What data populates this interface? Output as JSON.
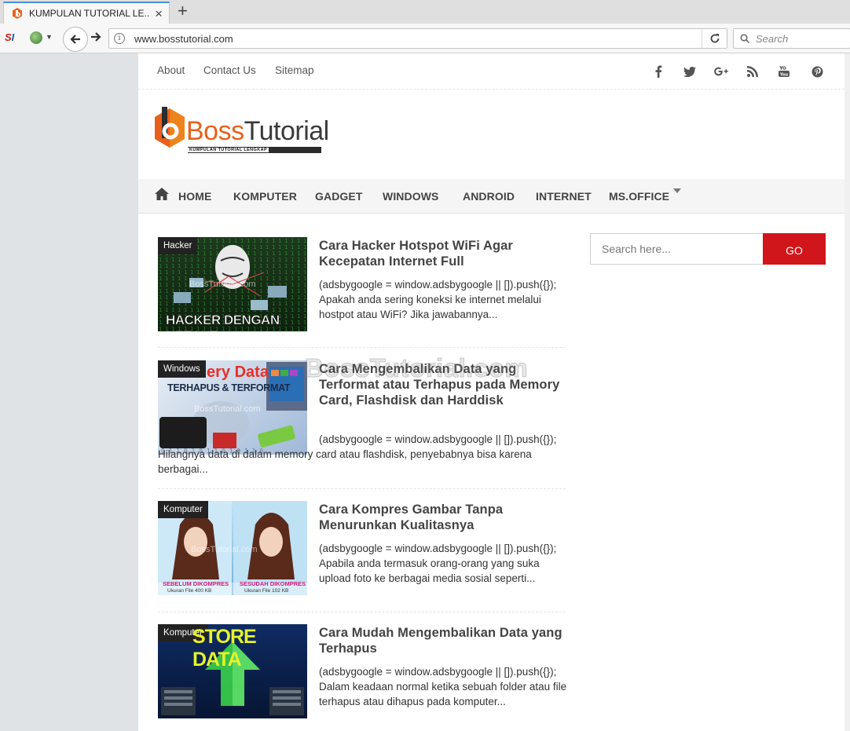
{
  "browser": {
    "tab_title": "KUMPULAN TUTORIAL LE...",
    "new_tab": "+",
    "close": "×",
    "url": "www.bosstutorial.com",
    "search_placeholder": "Search",
    "ext_si": "S",
    "ext_si_i": "I"
  },
  "topnav": {
    "links": [
      "About",
      "Contact Us",
      "Sitemap"
    ],
    "social_icons": [
      "facebook-icon",
      "twitter-icon",
      "google-plus-icon",
      "rss-icon",
      "youtube-icon",
      "pinterest-icon"
    ]
  },
  "logo": {
    "word_boss": "Boss",
    "word_tutorial": "Tutorial",
    "tagline": "KUMPULAN TUTORIAL LENGKAP"
  },
  "mainnav": {
    "items": [
      "HOME",
      "KOMPUTER",
      "GADGET",
      "WINDOWS",
      "ANDROID",
      "INTERNET",
      "MS.OFFICE"
    ]
  },
  "watermark": "BossTutorial.com",
  "posts": [
    {
      "category": "Hacker",
      "title": "Cara Hacker Hotspot WiFi Agar Kecepatan Internet Full",
      "excerpt": "(adsbygoogle = window.adsbygoogle || []).push({}); Apakah anda sering koneksi ke internet melalui hostpot atau WiFi? Jika jawabannya...",
      "thumb_caption": "HACKER DENGAN NETCUT",
      "thumb_watermark": "BossTutorial.com"
    },
    {
      "category": "Windows",
      "title": "Cara Mengembalikan Data yang Terformat atau Terhapus pada Memory Card, Flashdisk dan Harddisk",
      "excerpt": "(adsbygoogle = window.adsbygoogle || []).push({}); Hilangnya data di dalam memory card atau flashdisk, penyebabnya bisa karena berbagai...",
      "thumb_caption_1": "ery Data",
      "thumb_caption_2": "TERHAPUS & TERFORMAT",
      "thumb_watermark": "BossTutorial.com"
    },
    {
      "category": "Komputer",
      "title": "Cara Kompres Gambar Tanpa Menurunkan Kualitasnya",
      "excerpt": "(adsbygoogle = window.adsbygoogle || []).push({}); Apabila anda termasuk orang-orang yang suka upload foto ke berbagai media sosial seperti...",
      "thumb_caption_1": "SEBELUM DIKOMPRES",
      "thumb_caption_2": "SESUDAH DIKOMPRES",
      "thumb_sub_1": "Ukuran File 400 KB",
      "thumb_sub_2": "Ukuran File 102 KB",
      "thumb_watermark": "BossTutorial.com"
    },
    {
      "category": "Komputer",
      "title": "Cara Mudah Mengembalikan Data yang Terhapus",
      "excerpt": "(adsbygoogle = window.adsbygoogle || []).push({}); Dalam keadaan normal ketika sebuah folder atau file terhapus atau dihapus pada komputer...",
      "thumb_caption": "STORE DATA"
    }
  ],
  "sidebar": {
    "search_placeholder": "Search here...",
    "go_label": "GO"
  },
  "colors": {
    "accent_red": "#d0161b",
    "logo_orange": "#e8601c"
  }
}
